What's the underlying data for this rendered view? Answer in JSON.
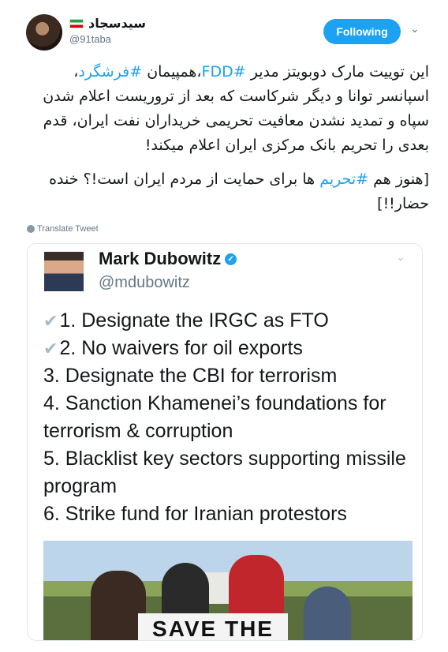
{
  "author": {
    "display_name": "سیدسجاد",
    "handle": "@91taba"
  },
  "follow_label": "Following",
  "tweet": {
    "paragraph1_parts": [
      "این توییت مارک دوبویتز مدیر ",
      "#FDD",
      "،همپیمان ",
      "#فرشگرد",
      "، اسپانسر توانا و دیگر شرکاست که بعد از تروریست اعلام شدن سپاه و تمدید نشدن معافیت تحریمی خریداران نفت ایران، قدم بعدی را تحریم بانک مرکزی ایران اعلام میکند!"
    ],
    "paragraph2_parts": [
      "[هنوز هم ",
      "#تحریم",
      " ها برای حمایت از مردم ایران است!؟ خنده حضار!!]"
    ]
  },
  "translate_label": "Translate Tweet",
  "quoted": {
    "name": "Mark Dubowitz",
    "handle": "@mdubowitz",
    "list": [
      {
        "checked": true,
        "text": "1. Designate the IRGC as FTO"
      },
      {
        "checked": true,
        "text": "2. No waivers for oil exports"
      },
      {
        "checked": false,
        "text": "3. Designate the CBI for terrorism"
      },
      {
        "checked": false,
        "text": "4. Sanction Khamenei’s foundations for terrorism & corruption"
      },
      {
        "checked": false,
        "text": "5. Blacklist key sectors supporting missile program"
      },
      {
        "checked": false,
        "text": "6. Strike fund for Iranian protestors"
      }
    ],
    "photo_banner_text": "SAVE THE"
  },
  "icons": {
    "caret": "chevron-down-icon",
    "verified": "verified-badge-icon",
    "globe": "globe-icon",
    "check": "checkmark-icon"
  },
  "colors": {
    "accent": "#1da1f2",
    "text": "#14171a",
    "muted": "#657786"
  }
}
